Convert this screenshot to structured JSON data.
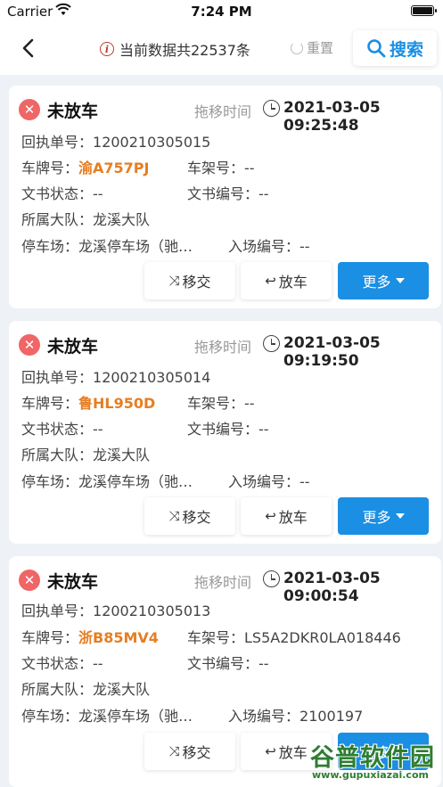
{
  "status_bar": {
    "carrier": "Carrier",
    "time": "7:24 PM"
  },
  "navbar": {
    "count_text": "当前数据共22537条",
    "reset_label": "重置",
    "search_label": "搜索"
  },
  "labels": {
    "receipt_no": "回执单号：",
    "plate": "车牌号：",
    "frame": "车架号：",
    "doc_status": "文书状态：",
    "doc_no": "文书编号：",
    "team": "所属大队：",
    "lot": "停车场：",
    "entry_no": "入场编号：",
    "tow_time": "拖移时间",
    "transfer": "移交",
    "release": "放车",
    "more": "更多"
  },
  "records": [
    {
      "status": "未放车",
      "tow_time": "2021-03-05 09:25:48",
      "receipt_no": "1200210305015",
      "plate": "渝A757PJ",
      "frame": "--",
      "doc_status": "--",
      "doc_no": "--",
      "team": "龙溪大队",
      "lot": "龙溪停车场（驰…",
      "entry_no": "--"
    },
    {
      "status": "未放车",
      "tow_time": "2021-03-05 09:19:50",
      "receipt_no": "1200210305014",
      "plate": "鲁HL950D",
      "frame": "--",
      "doc_status": "--",
      "doc_no": "--",
      "team": "龙溪大队",
      "lot": "龙溪停车场（驰…",
      "entry_no": "--"
    },
    {
      "status": "未放车",
      "tow_time": "2021-03-05 09:00:54",
      "receipt_no": "1200210305013",
      "plate": "浙B85MV4",
      "frame": "LS5A2DKR0LA018446",
      "doc_status": "--",
      "doc_no": "--",
      "team": "龙溪大队",
      "lot": "龙溪停车场（驰…",
      "entry_no": "2100197"
    }
  ],
  "watermark": {
    "title": "谷普软件园",
    "url": "www.gupuxiazai.com"
  },
  "colors": {
    "accent": "#1a8fe3",
    "plate": "#e67e22",
    "status_red": "#f06565"
  }
}
